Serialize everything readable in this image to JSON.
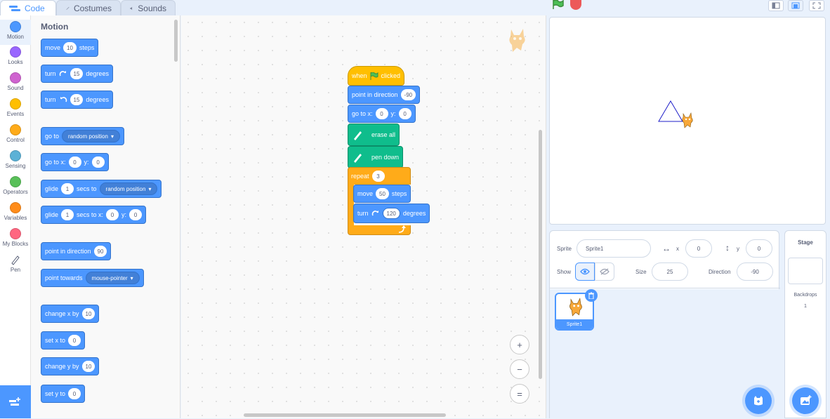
{
  "tabs": [
    {
      "label": "Code",
      "icon": "code-icon"
    },
    {
      "label": "Costumes",
      "icon": "brush-icon"
    },
    {
      "label": "Sounds",
      "icon": "speaker-icon"
    }
  ],
  "categories": [
    {
      "label": "Motion",
      "color": "#4c97ff"
    },
    {
      "label": "Looks",
      "color": "#9966ff"
    },
    {
      "label": "Sound",
      "color": "#cf63cf"
    },
    {
      "label": "Events",
      "color": "#ffbf00"
    },
    {
      "label": "Control",
      "color": "#ffab19"
    },
    {
      "label": "Sensing",
      "color": "#5cb1d6"
    },
    {
      "label": "Operators",
      "color": "#59c059"
    },
    {
      "label": "Variables",
      "color": "#ff8c1a"
    },
    {
      "label": "My Blocks",
      "color": "#ff6680"
    },
    {
      "label": "Pen",
      "color": "#0fbd8c"
    }
  ],
  "palette": {
    "title": "Motion",
    "move": {
      "pre": "move",
      "val": "10",
      "post": "steps"
    },
    "turn_right": {
      "pre": "turn",
      "val": "15",
      "post": "degrees"
    },
    "turn_left": {
      "pre": "turn",
      "val": "15",
      "post": "degrees"
    },
    "goto": {
      "pre": "go to",
      "menu": "random position"
    },
    "gotoxy": {
      "pre": "go to x:",
      "x": "0",
      "ylbl": "y:",
      "y": "0"
    },
    "glide1": {
      "pre": "glide",
      "val": "1",
      "mid": "secs to",
      "menu": "random position"
    },
    "glide2": {
      "pre": "glide",
      "val": "1",
      "mid": "secs to x:",
      "x": "0",
      "ylbl": "y:",
      "y": "0"
    },
    "point_dir": {
      "pre": "point in direction",
      "val": "90"
    },
    "point_towards": {
      "pre": "point towards",
      "menu": "mouse-pointer"
    },
    "change_x": {
      "pre": "change x by",
      "val": "10"
    },
    "set_x": {
      "pre": "set x to",
      "val": "0"
    },
    "change_y": {
      "pre": "change y by",
      "val": "10"
    },
    "set_y": {
      "pre": "set y to",
      "val": "0"
    }
  },
  "script": {
    "hat": {
      "pre": "when",
      "post": "clicked"
    },
    "point_dir": {
      "pre": "point in direction",
      "val": "-90"
    },
    "gotoxy": {
      "pre": "go to x:",
      "x": "0",
      "ylbl": "y:",
      "y": "0"
    },
    "erase": "erase all",
    "pendown": "pen down",
    "repeat": {
      "pre": "repeat",
      "val": "3"
    },
    "move": {
      "pre": "move",
      "val": "50",
      "post": "steps"
    },
    "turn": {
      "pre": "turn",
      "val": "120",
      "post": "degrees"
    }
  },
  "zoom": {
    "in": "+",
    "out": "−",
    "reset": "="
  },
  "sprite_info": {
    "sprite_label": "Sprite",
    "sprite_name": "Sprite1",
    "x_label": "x",
    "x_val": "0",
    "y_label": "y",
    "y_val": "0",
    "show_label": "Show",
    "size_label": "Size",
    "size_val": "25",
    "direction_label": "Direction",
    "direction_val": "-90"
  },
  "sprites": [
    {
      "name": "Sprite1"
    }
  ],
  "stage_pane": {
    "title": "Stage",
    "backdrops_label": "Backdrops",
    "backdrops_count": "1"
  }
}
